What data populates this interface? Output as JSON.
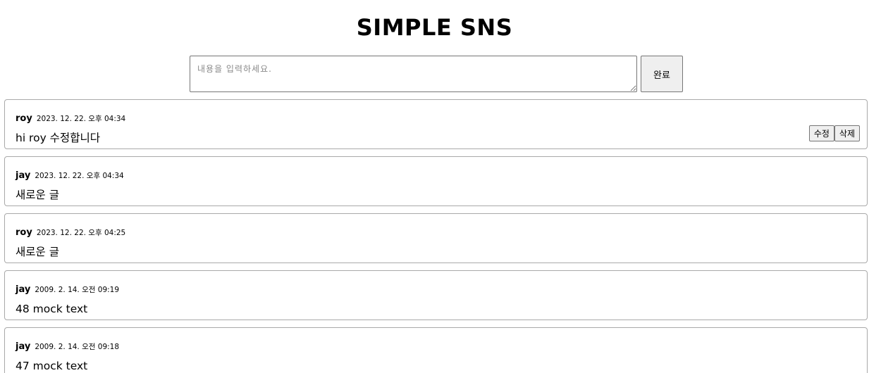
{
  "header": {
    "title": "SIMPLE SNS"
  },
  "composer": {
    "placeholder": "내용을 입력하세요.",
    "value": "",
    "submit_label": "완료"
  },
  "posts": [
    {
      "author": "roy",
      "time": "2023. 12. 22. 오후 04:34",
      "content": "hi roy 수정합니다",
      "edit_label": "수정",
      "delete_label": "삭제"
    },
    {
      "author": "jay",
      "time": "2023. 12. 22. 오후 04:34",
      "content": "새로운 글"
    },
    {
      "author": "roy",
      "time": "2023. 12. 22. 오후 04:25",
      "content": "새로운 글"
    },
    {
      "author": "jay",
      "time": "2009. 2. 14. 오전 09:19",
      "content": "48 mock text"
    },
    {
      "author": "jay",
      "time": "2009. 2. 14. 오전 09:18",
      "content": "47 mock text"
    }
  ]
}
